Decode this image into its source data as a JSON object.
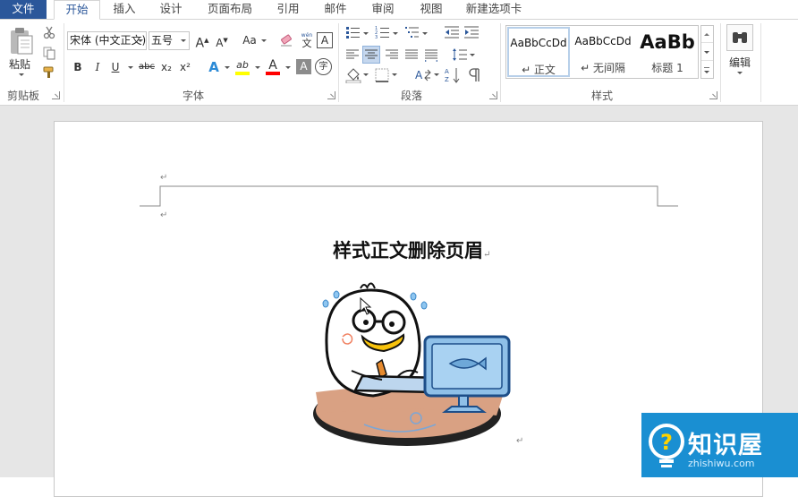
{
  "tabs": [
    {
      "label": "文件"
    },
    {
      "label": "开始"
    },
    {
      "label": "插入"
    },
    {
      "label": "设计"
    },
    {
      "label": "页面布局"
    },
    {
      "label": "引用"
    },
    {
      "label": "邮件"
    },
    {
      "label": "审阅"
    },
    {
      "label": "视图"
    },
    {
      "label": "新建选项卡"
    }
  ],
  "ribbon": {
    "clipboard": {
      "paste_label": "粘贴",
      "group_label": "剪贴板"
    },
    "font": {
      "font_name": "宋体 (中文正文)",
      "font_size": "五号",
      "grow_label": "A",
      "shrink_label": "A",
      "case_label": "Aa",
      "pinyin_label": "wén",
      "border_label": "A",
      "bold": "B",
      "italic": "I",
      "underline": "U",
      "strike": "abc",
      "subscript": "x₂",
      "superscript": "x²",
      "effects": "A",
      "highlight": "ab",
      "color": "A",
      "shade": "A",
      "enclose": "字",
      "group_label": "字体"
    },
    "paragraph": {
      "group_label": "段落"
    },
    "styles": {
      "items": [
        {
          "sample": "AaBbCcDd",
          "name": "↵ 正文"
        },
        {
          "sample": "AaBbCcDd",
          "name": "↵ 无间隔"
        },
        {
          "sample": "AaBb",
          "name": "标题 1"
        }
      ],
      "group_label": "样式"
    },
    "editing": {
      "label": "编辑"
    }
  },
  "document": {
    "title": "样式正文删除页眉",
    "para_mark": "↵"
  },
  "watermark": {
    "title": "知识屋",
    "subtitle": "zhishiwu.com"
  },
  "colors": {
    "accent": "#2b579a",
    "highlight": "#ffff00",
    "font_color": "#ff0000",
    "watermark_bg": "#1a8fd2"
  }
}
